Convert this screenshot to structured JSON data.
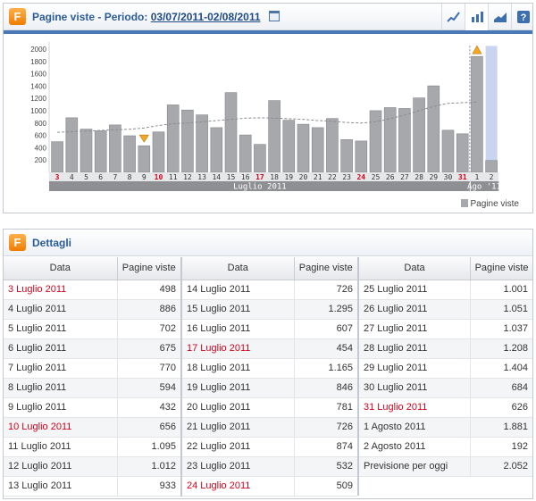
{
  "chart_panel": {
    "logo_letter": "F",
    "title_prefix": "Pagine viste - Periodo:",
    "period": "03/07/2011-02/08/2011",
    "tools": [
      "line-chart-icon",
      "bar-chart-icon",
      "area-chart-icon",
      "help-icon"
    ]
  },
  "chart_data": {
    "type": "bar",
    "ylim": [
      0,
      2000
    ],
    "yticks": [
      "2000",
      "1800",
      "1600",
      "1400",
      "1200",
      "1000",
      "800",
      "600",
      "400",
      "200"
    ],
    "categories": [
      "3",
      "4",
      "5",
      "6",
      "7",
      "8",
      "9",
      "10",
      "11",
      "12",
      "13",
      "14",
      "15",
      "16",
      "17",
      "18",
      "19",
      "20",
      "21",
      "22",
      "23",
      "24",
      "25",
      "26",
      "27",
      "28",
      "29",
      "30",
      "31",
      "1",
      "2"
    ],
    "values": [
      498,
      886,
      702,
      675,
      770,
      594,
      432,
      656,
      1095,
      1012,
      933,
      726,
      1295,
      607,
      454,
      1165,
      846,
      781,
      726,
      874,
      532,
      509,
      1001,
      1051,
      1037,
      1208,
      1404,
      684,
      626,
      1881,
      192
    ],
    "forecast_value": 2052,
    "trend": [
      650,
      660,
      670,
      680,
      690,
      700,
      720,
      760,
      790,
      800,
      820,
      840,
      860,
      880,
      885,
      880,
      870,
      860,
      840,
      830,
      810,
      800,
      820,
      870,
      930,
      1000,
      1070,
      1120,
      1130,
      1140
    ],
    "weekend_categories": [
      "3",
      "10",
      "17",
      "24",
      "31"
    ],
    "low_marker_category": "9",
    "high_marker_category": "1",
    "month_labels": [
      "Luglio 2011",
      "Ago '11"
    ],
    "legend": "Pagine viste",
    "colors": {
      "bar": "#a6a8ac",
      "bar_edge": "#85878b",
      "weekend": "#d0021b",
      "forecast": "#c9d4f0",
      "marker": "#f5a623"
    }
  },
  "details_panel": {
    "logo_letter": "F",
    "title": "Dettagli",
    "header_date": "Data",
    "header_views": "Pagine viste",
    "columns": [
      [
        {
          "date": "3 Luglio 2011",
          "value": "498",
          "red": true
        },
        {
          "date": "4 Luglio 2011",
          "value": "886"
        },
        {
          "date": "5 Luglio 2011",
          "value": "702"
        },
        {
          "date": "6 Luglio 2011",
          "value": "675"
        },
        {
          "date": "7 Luglio 2011",
          "value": "770"
        },
        {
          "date": "8 Luglio 2011",
          "value": "594"
        },
        {
          "date": "9 Luglio 2011",
          "value": "432"
        },
        {
          "date": "10 Luglio 2011",
          "value": "656",
          "red": true
        },
        {
          "date": "11 Luglio 2011",
          "value": "1.095"
        },
        {
          "date": "12 Luglio 2011",
          "value": "1.012"
        },
        {
          "date": "13 Luglio 2011",
          "value": "933"
        }
      ],
      [
        {
          "date": "14 Luglio 2011",
          "value": "726"
        },
        {
          "date": "15 Luglio 2011",
          "value": "1.295"
        },
        {
          "date": "16 Luglio 2011",
          "value": "607"
        },
        {
          "date": "17 Luglio 2011",
          "value": "454",
          "red": true
        },
        {
          "date": "18 Luglio 2011",
          "value": "1.165"
        },
        {
          "date": "19 Luglio 2011",
          "value": "846"
        },
        {
          "date": "20 Luglio 2011",
          "value": "781"
        },
        {
          "date": "21 Luglio 2011",
          "value": "726"
        },
        {
          "date": "22 Luglio 2011",
          "value": "874"
        },
        {
          "date": "23 Luglio 2011",
          "value": "532"
        },
        {
          "date": "24 Luglio 2011",
          "value": "509",
          "red": true
        }
      ],
      [
        {
          "date": "25 Luglio 2011",
          "value": "1.001"
        },
        {
          "date": "26 Luglio 2011",
          "value": "1.051"
        },
        {
          "date": "27 Luglio 2011",
          "value": "1.037"
        },
        {
          "date": "28 Luglio 2011",
          "value": "1.208"
        },
        {
          "date": "29 Luglio 2011",
          "value": "1.404"
        },
        {
          "date": "30 Luglio 2011",
          "value": "684"
        },
        {
          "date": "31 Luglio 2011",
          "value": "626",
          "red": true
        },
        {
          "date": "1 Agosto 2011",
          "value": "1.881"
        },
        {
          "date": "2 Agosto 2011",
          "value": "192"
        },
        {
          "date": "Previsione per oggi",
          "value": "2.052"
        },
        {
          "date": "",
          "value": "",
          "empty": true
        }
      ]
    ]
  }
}
